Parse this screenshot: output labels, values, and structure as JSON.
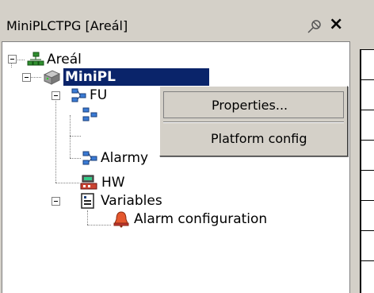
{
  "panel": {
    "title": "MiniPLCTPG [Areál]",
    "pin_icon": "pin-icon",
    "close_label": "×"
  },
  "tree": {
    "root": {
      "label": "Areál",
      "icon": "network-icon"
    },
    "project": {
      "label": "MiniPLCTPG",
      "label_visible": "MiniPL",
      "icon": "plc-device-icon"
    },
    "fu": {
      "label": "FU",
      "icon": "function-block-icon"
    },
    "child_hidden": {
      "label": "",
      "icon": "function-block-icon"
    },
    "alarmy": {
      "label": "Alarmy",
      "icon": "function-block-icon"
    },
    "hw": {
      "label": "HW",
      "icon": "hardware-icon"
    },
    "variables": {
      "label": "Variables",
      "icon": "variables-icon"
    },
    "alarm_config": {
      "label": "Alarm configuration",
      "icon": "alarm-bell-icon"
    }
  },
  "context_menu": {
    "items": [
      {
        "label": "Properties..."
      },
      {
        "label": "Platform config"
      }
    ]
  },
  "colors": {
    "selection": "#0a246a",
    "window": "#d4d0c8"
  }
}
